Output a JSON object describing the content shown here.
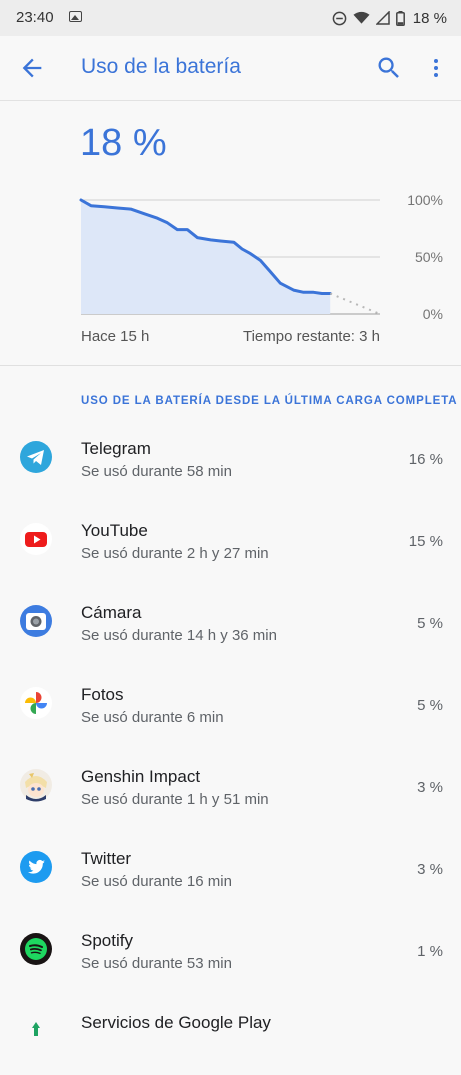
{
  "status_bar": {
    "time": "23:40",
    "battery_percent": "18 %",
    "icons": [
      "image-icon",
      "do-not-disturb-icon",
      "wifi-icon",
      "signal-icon",
      "battery-icon"
    ]
  },
  "app_bar": {
    "title": "Uso de la batería",
    "back_icon": "arrow-back-icon",
    "search_icon": "search-icon",
    "menu_icon": "more-vert-icon"
  },
  "battery_level": "18 %",
  "chart_labels": {
    "start": "Hace 15 h",
    "remaining": "Tiempo restante: 3 h"
  },
  "chart_data": {
    "type": "area",
    "title": "",
    "xlabel": "",
    "ylabel": "",
    "y_ticks": [
      "100%",
      "50%",
      "0%"
    ],
    "ylim": [
      0,
      100
    ],
    "xlim": [
      -15,
      3
    ],
    "x": [
      -15,
      -14.4,
      -13.6,
      -12.8,
      -12,
      -11.2,
      -10.4,
      -9.8,
      -9.2,
      -8.6,
      -8.0,
      -7.2,
      -6.6,
      -5.8,
      -5.3,
      -4.8,
      -4.2,
      -3.6,
      -3.0,
      -2.2,
      -1.6,
      -1.0,
      -0.5,
      0
    ],
    "values": [
      100,
      95,
      94,
      93,
      92,
      88,
      84,
      80,
      74,
      74,
      67,
      65,
      64,
      63,
      57,
      53,
      47,
      37,
      27,
      21,
      19,
      19,
      18,
      18
    ],
    "projection": {
      "x": [
        0,
        3
      ],
      "values": [
        18,
        0
      ]
    },
    "grid": true,
    "colors": {
      "line": "#3b74d8",
      "fill": "#dde7f8",
      "grid": "#d0d0d0"
    }
  },
  "section_header": "USO DE LA BATERÍA DESDE LA ÚLTIMA CARGA COMPLETA",
  "apps": [
    {
      "name": "Telegram",
      "usage": "Se usó durante 58 min",
      "percent": "16 %",
      "icon": "telegram-icon"
    },
    {
      "name": "YouTube",
      "usage": "Se usó durante 2 h y 27 min",
      "percent": "15 %",
      "icon": "youtube-icon"
    },
    {
      "name": "Cámara",
      "usage": "Se usó durante 14 h y 36 min",
      "percent": "5 %",
      "icon": "camera-icon"
    },
    {
      "name": "Fotos",
      "usage": "Se usó durante 6 min",
      "percent": "5 %",
      "icon": "photos-icon"
    },
    {
      "name": "Genshin Impact",
      "usage": "Se usó durante 1 h y 51 min",
      "percent": "3 %",
      "icon": "genshin-impact-icon"
    },
    {
      "name": "Twitter",
      "usage": "Se usó durante 16 min",
      "percent": "3 %",
      "icon": "twitter-icon"
    },
    {
      "name": "Spotify",
      "usage": "Se usó durante 53 min",
      "percent": "1 %",
      "icon": "spotify-icon"
    },
    {
      "name": "Servicios de Google Play",
      "usage": "",
      "percent": "",
      "icon": "google-play-services-icon"
    }
  ],
  "colors": {
    "accent": "#3b74d8",
    "background": "#f8f8f8"
  }
}
